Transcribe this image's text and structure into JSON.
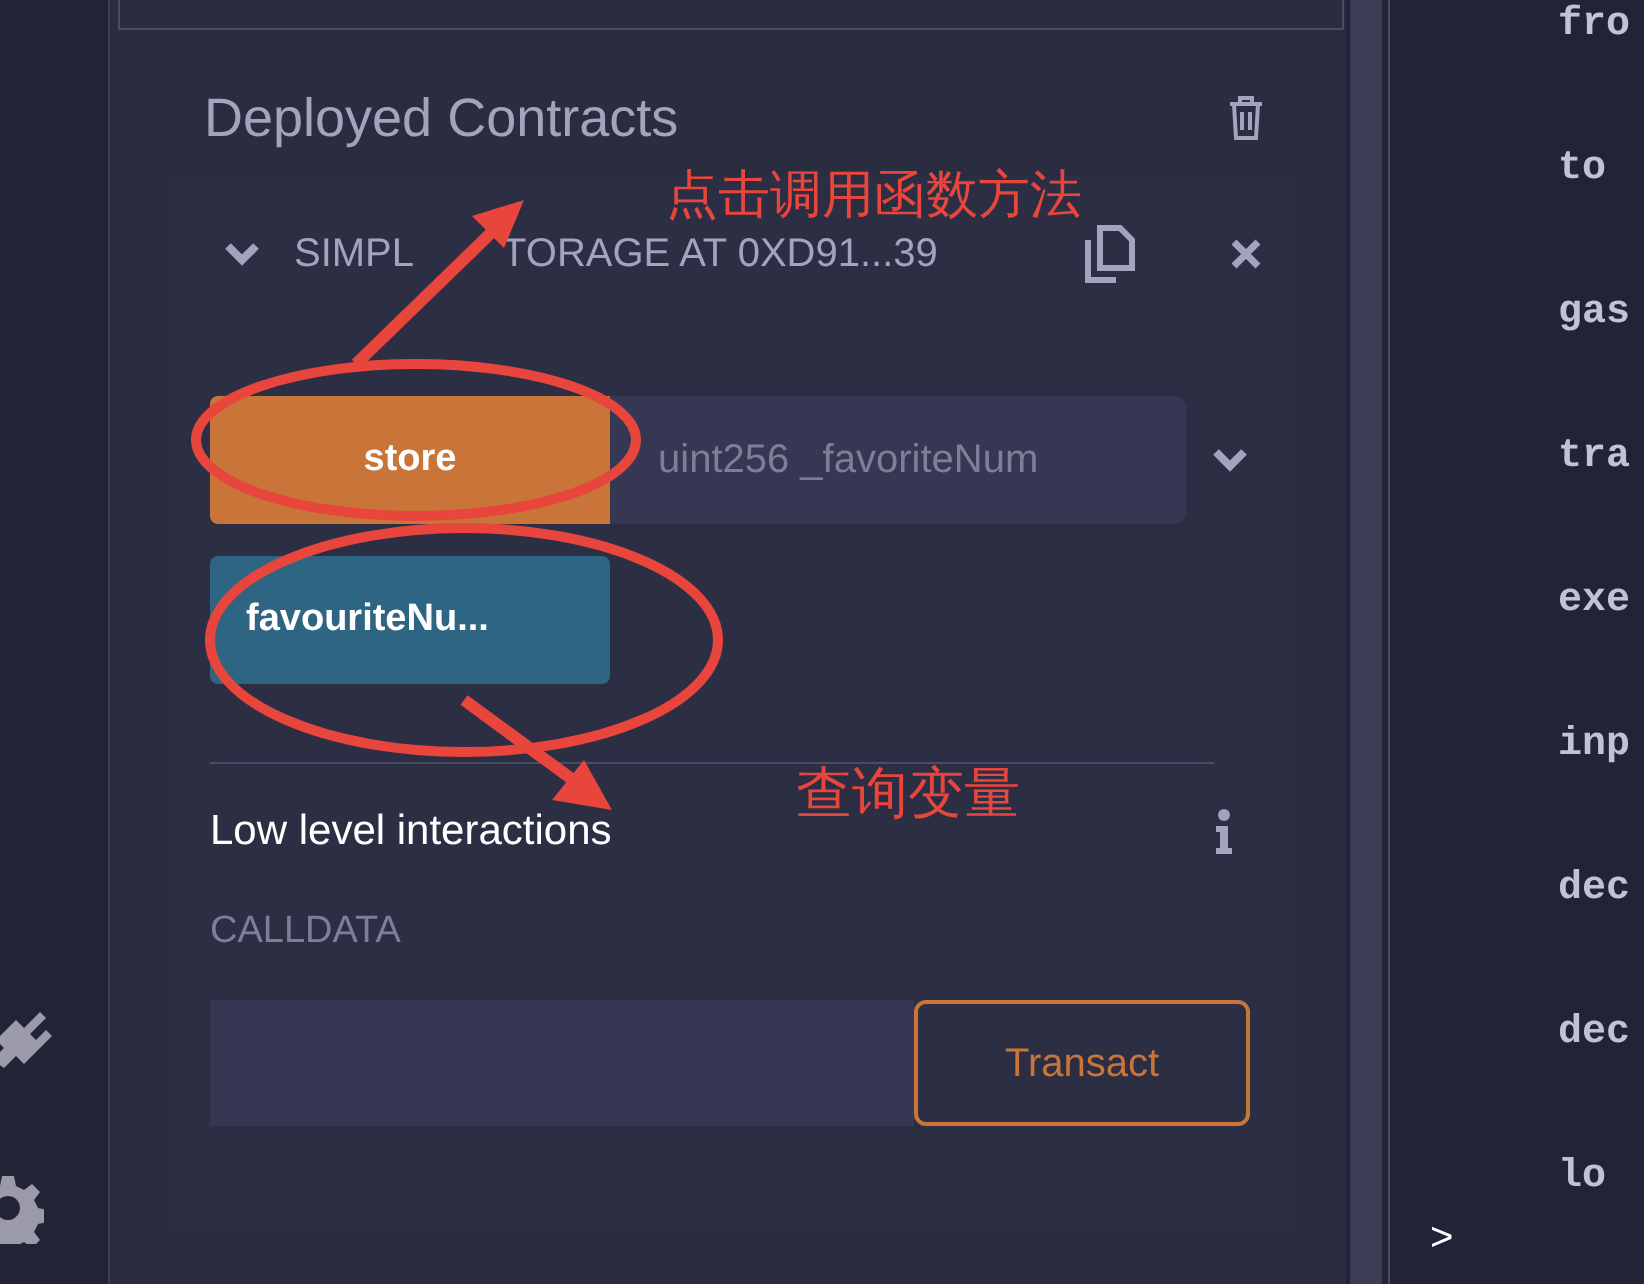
{
  "deployed_contracts": {
    "title": "Deployed Contracts",
    "contract": {
      "title_parts": [
        "SIMPL",
        "TORAGE AT 0XD91...39"
      ],
      "expanded": true,
      "functions": [
        {
          "kind": "transact",
          "label": "store",
          "placeholder": "uint256 _favoriteNum"
        },
        {
          "kind": "call",
          "label": "favouriteNu..."
        }
      ],
      "low_level": {
        "title": "Low level interactions",
        "calldata_label": "CALLDATA",
        "button": "Transact"
      }
    }
  },
  "terminal": {
    "keys": [
      "fro",
      "to",
      "gas",
      "tra",
      "exe",
      "inp",
      "dec",
      "dec",
      "lo"
    ],
    "prompt": ">"
  },
  "annotations": [
    {
      "text": "点击调用函数方法"
    },
    {
      "text": "查询变量"
    }
  ]
}
